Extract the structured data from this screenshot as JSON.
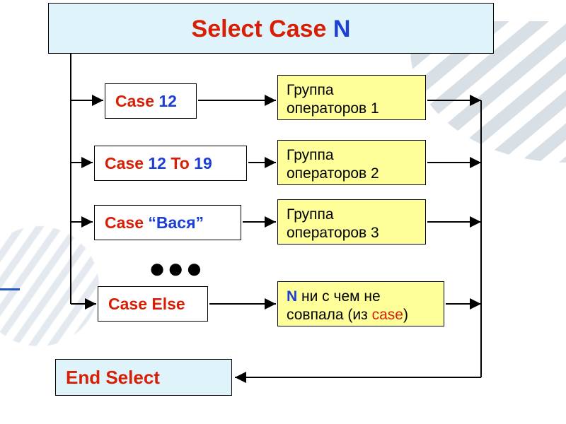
{
  "header": {
    "kw": "Select Case",
    "var": "N"
  },
  "cases": [
    {
      "kw": "Case",
      "kw2": "",
      "val": "12",
      "tail": ""
    },
    {
      "kw": "Case",
      "kw2": "To",
      "val": "12",
      "val2": "19"
    },
    {
      "kw": "Case",
      "kw2": "",
      "val": "“Вася”"
    },
    {
      "kw": "Case Else",
      "kw2": "",
      "val": ""
    }
  ],
  "ops": [
    {
      "text": "Группа операторов 1"
    },
    {
      "text": "Группа операторов 2"
    },
    {
      "text": "Группа операторов 3"
    },
    {
      "n": "N",
      "mid": "  ни с чем не совпала (из ",
      "kw": "case",
      "tail": ")"
    }
  ],
  "end": "End Select",
  "ellipsis": "●●●",
  "chart_data": {
    "type": "table",
    "title": "Select Case N flowchart",
    "nodes": [
      {
        "id": "header",
        "label": "Select Case N"
      },
      {
        "id": "case1",
        "label": "Case 12"
      },
      {
        "id": "case2",
        "label": "Case 12 To 19"
      },
      {
        "id": "case3",
        "label": "Case \"Вася\""
      },
      {
        "id": "caseElse",
        "label": "Case Else"
      },
      {
        "id": "op1",
        "label": "Группа операторов 1"
      },
      {
        "id": "op2",
        "label": "Группа операторов 2"
      },
      {
        "id": "op3",
        "label": "Группа операторов 3"
      },
      {
        "id": "opElse",
        "label": "N ни с чем не совпала (из case)"
      },
      {
        "id": "end",
        "label": "End Select"
      }
    ],
    "edges": [
      [
        "header",
        "case1"
      ],
      [
        "header",
        "case2"
      ],
      [
        "header",
        "case3"
      ],
      [
        "header",
        "caseElse"
      ],
      [
        "case1",
        "op1"
      ],
      [
        "case2",
        "op2"
      ],
      [
        "case3",
        "op3"
      ],
      [
        "caseElse",
        "opElse"
      ],
      [
        "op1",
        "end"
      ],
      [
        "op2",
        "end"
      ],
      [
        "op3",
        "end"
      ],
      [
        "opElse",
        "end"
      ]
    ]
  }
}
